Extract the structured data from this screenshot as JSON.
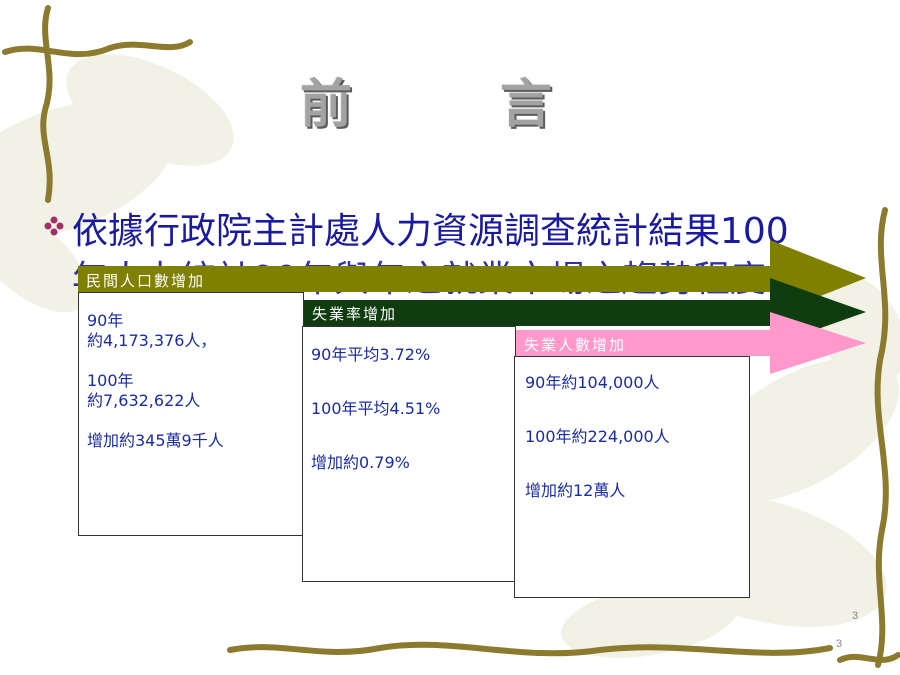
{
  "slide": {
    "title": "前　言",
    "bullet": "依據行政院主計處人力資源調查統計結果100",
    "bullet_line2": "年人力統計90年與年之就業市場之趨勢程度",
    "page_number": "3",
    "page_number_footer": "3"
  },
  "arrows": [
    {
      "label": "民間人口數增加",
      "color": "#7f7f00",
      "text_color": "#ffffff"
    },
    {
      "label": "失業率增加",
      "color": "#0f3d0f",
      "text_color": "#ffffff"
    },
    {
      "label": "失業人數增加",
      "color": "#ff99cc",
      "text_color": "#ffffff"
    }
  ],
  "boxes": [
    {
      "lines": [
        "90年",
        "約4,173,376人，",
        "",
        "100年",
        "約7,632,622人",
        "",
        "增加約345萬9千人"
      ]
    },
    {
      "lines": [
        "90年平均3.72%",
        "",
        "100年平均4.51%",
        "",
        "增加約0.79%"
      ]
    },
    {
      "lines": [
        "90年約104,000人",
        "",
        "100年約224,000人",
        "",
        "增加約12萬人"
      ]
    }
  ],
  "colors": {
    "text_blue": "#1a2aa8",
    "bullet_blue": "#1a1aa0",
    "vine": "#8c7a2e"
  }
}
